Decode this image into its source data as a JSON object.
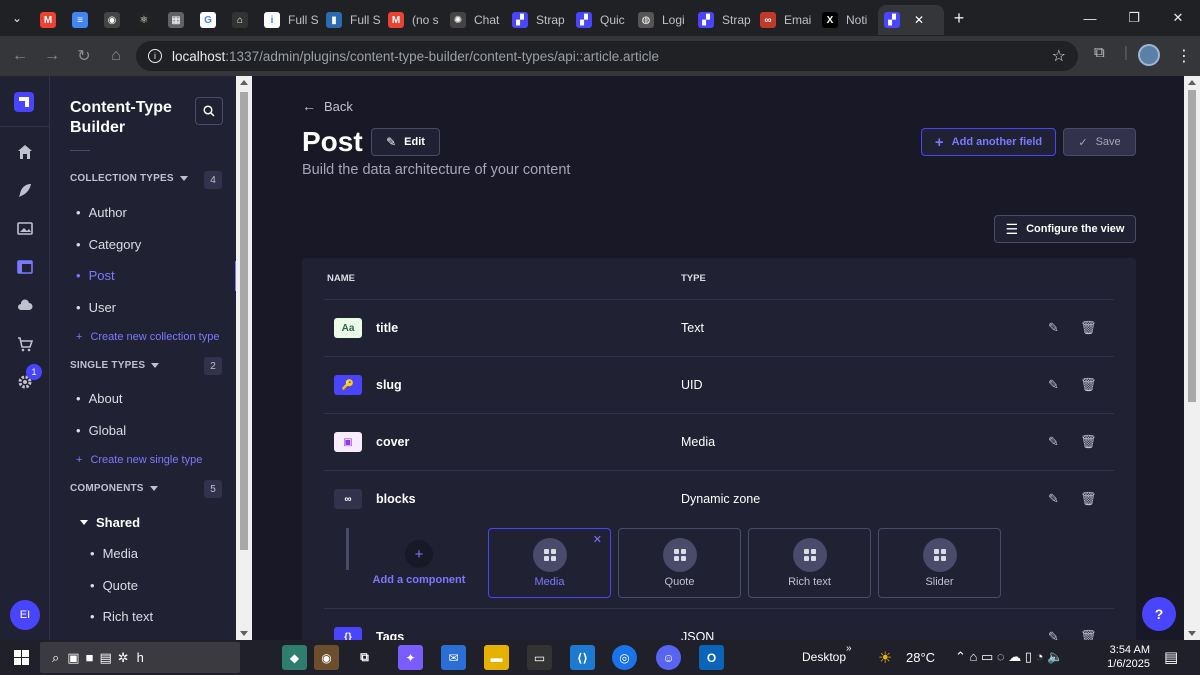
{
  "browser": {
    "tabs": [
      {
        "label": "",
        "favicon": "gmail-icon",
        "color": "#ea4335",
        "glyph": "M"
      },
      {
        "label": "",
        "favicon": "docs-icon",
        "color": "#4285f4",
        "glyph": "≡"
      },
      {
        "label": "",
        "favicon": "app-icon",
        "color": "#444",
        "glyph": "◉"
      },
      {
        "label": "",
        "favicon": "react-icon",
        "color": "#222",
        "glyph": "⚛"
      },
      {
        "label": "",
        "favicon": "sheet-icon",
        "color": "#5f6368",
        "glyph": "▦"
      },
      {
        "label": "",
        "favicon": "google-icon",
        "color": "#fff",
        "glyph": "G"
      },
      {
        "label": "",
        "favicon": "store-icon",
        "color": "#333",
        "glyph": "⌂"
      },
      {
        "label": "Full S",
        "favicon": "info-icon",
        "color": "#fff",
        "glyph": "i"
      },
      {
        "label": "Full S",
        "favicon": "bookmark-icon",
        "color": "#2b6cb0",
        "glyph": "▮"
      },
      {
        "label": "(no s",
        "favicon": "gmail-icon",
        "color": "#ea4335",
        "glyph": "M"
      },
      {
        "label": "Chat",
        "favicon": "chatgpt-icon",
        "color": "#444",
        "glyph": "✺"
      },
      {
        "label": "Strap",
        "favicon": "strapi-icon",
        "color": "#4945ff",
        "glyph": "▞"
      },
      {
        "label": "Quic",
        "favicon": "strapi-icon",
        "color": "#4945ff",
        "glyph": "▞"
      },
      {
        "label": "Logi",
        "favicon": "globe-icon",
        "color": "#555",
        "glyph": "◍"
      },
      {
        "label": "Strap",
        "favicon": "strapi-icon",
        "color": "#4945ff",
        "glyph": "▞"
      },
      {
        "label": "Emai",
        "favicon": "link-icon",
        "color": "#c0392b",
        "glyph": "∞"
      },
      {
        "label": "Noti",
        "favicon": "x-icon",
        "color": "#000",
        "glyph": "X"
      },
      {
        "label": "",
        "favicon": "strapi-icon",
        "color": "#4945ff",
        "glyph": "▞",
        "active": true
      }
    ],
    "url_host": "localhost",
    "url_path": ":1337/admin/plugins/content-type-builder/content-types/api::article.article"
  },
  "subnav": {
    "title": "Content-Type Builder",
    "collection_types": {
      "heading": "COLLECTION TYPES",
      "count": "4",
      "items": [
        "Author",
        "Category",
        "Post",
        "User"
      ],
      "active": "Post",
      "create_label": "Create new collection type"
    },
    "single_types": {
      "heading": "SINGLE TYPES",
      "count": "2",
      "items": [
        "About",
        "Global"
      ],
      "create_label": "Create new single type"
    },
    "components": {
      "heading": "COMPONENTS",
      "count": "5",
      "group": "Shared",
      "items": [
        "Media",
        "Quote",
        "Rich text"
      ]
    }
  },
  "rail": {
    "badge": "1",
    "avatar_initials": "EI"
  },
  "main": {
    "back_label": "Back",
    "title": "Post",
    "edit_label": "Edit",
    "subtitle": "Build the data architecture of your content",
    "add_field_label": "Add another field",
    "save_label": "Save",
    "configure_label": "Configure the view",
    "columns": {
      "name": "NAME",
      "type": "TYPE"
    },
    "fields": [
      {
        "name": "title",
        "type": "Text",
        "icon": "text-icon",
        "glyph": "Aa",
        "bg": "#eafbe7",
        "fg": "#2f6846"
      },
      {
        "name": "slug",
        "type": "UID",
        "icon": "key-icon",
        "glyph": "🔑",
        "bg": "#4945ff",
        "fg": "#ffffff"
      },
      {
        "name": "cover",
        "type": "Media",
        "icon": "image-icon",
        "glyph": "▣",
        "bg": "#f6ecfc",
        "fg": "#9736e8"
      },
      {
        "name": "blocks",
        "type": "Dynamic zone",
        "icon": "dynamic-zone-icon",
        "glyph": "∞",
        "bg": "#32324d",
        "fg": "#ffffff"
      },
      {
        "name": "Tags",
        "type": "JSON",
        "icon": "json-icon",
        "glyph": "{}",
        "bg": "#4945ff",
        "fg": "#ffffff"
      }
    ],
    "dynamic_zone": {
      "add_component_label": "Add a component",
      "components": [
        "Media",
        "Quote",
        "Rich text",
        "Slider"
      ],
      "selected": "Media"
    }
  },
  "taskbar": {
    "search_text": "h",
    "desktop_label": "Desktop",
    "weather": "28°C",
    "time": "3:54 AM",
    "date": "1/6/2025"
  }
}
